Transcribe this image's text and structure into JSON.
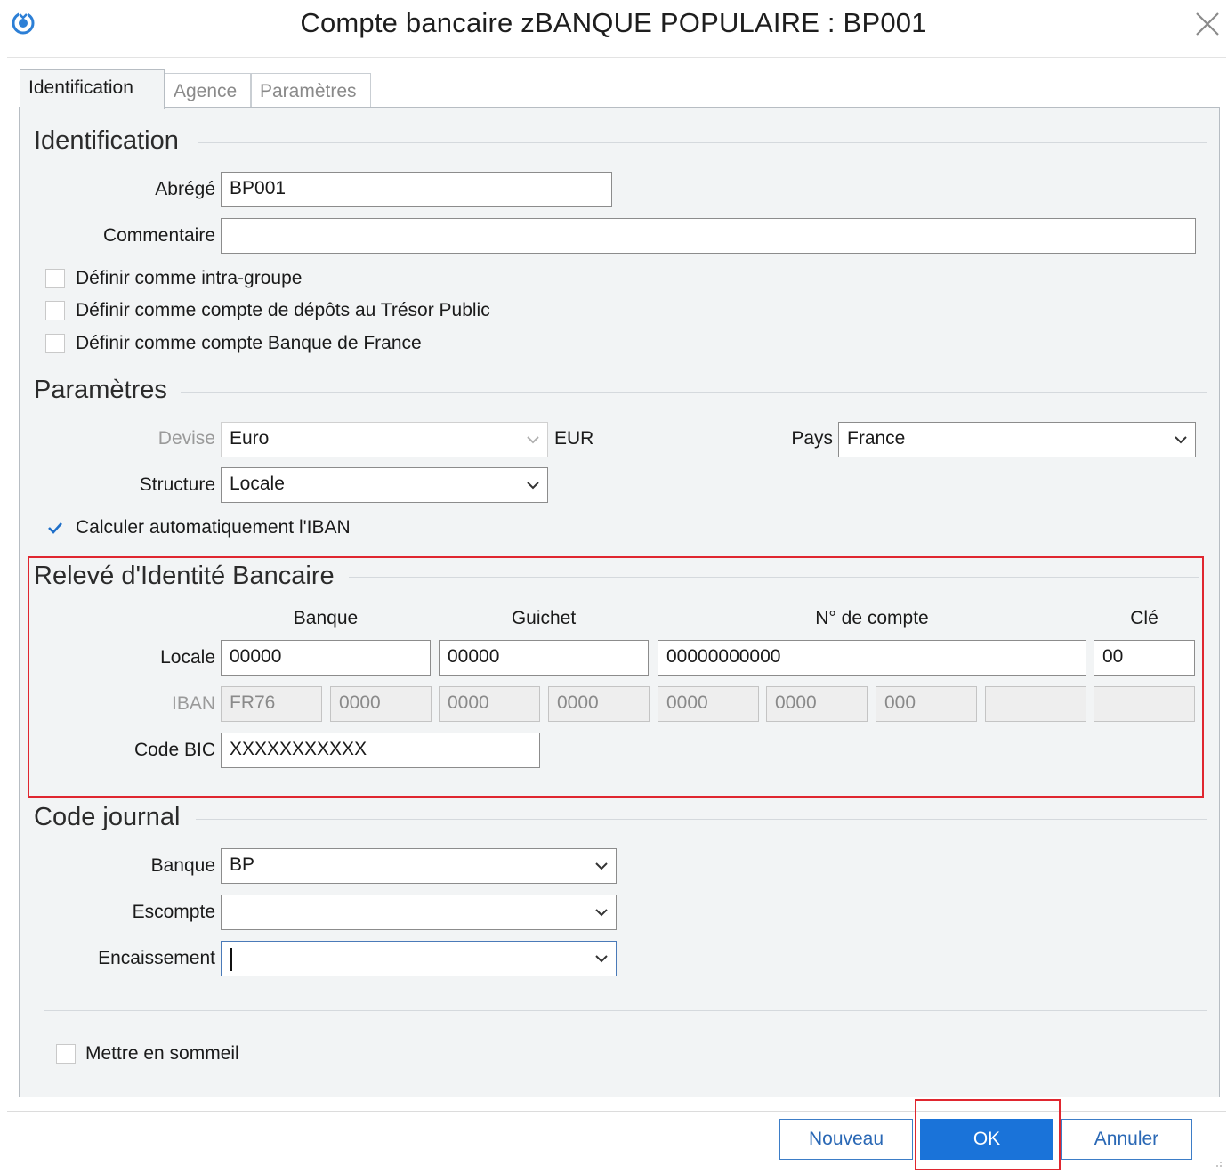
{
  "window": {
    "title": "Compte bancaire zBANQUE POPULAIRE : BP001"
  },
  "tabs": [
    {
      "label": "Identification",
      "active": true
    },
    {
      "label": "Agence",
      "active": false
    },
    {
      "label": "Paramètres",
      "active": false
    }
  ],
  "identification": {
    "section_title": "Identification",
    "abrege": {
      "label": "Abrégé",
      "value": "BP001"
    },
    "commentaire": {
      "label": "Commentaire",
      "value": ""
    },
    "checkboxes": [
      {
        "label": "Définir comme intra-groupe",
        "checked": false
      },
      {
        "label": "Définir comme compte de dépôts au Trésor Public",
        "checked": false
      },
      {
        "label": "Définir comme compte Banque de France",
        "checked": false
      }
    ]
  },
  "parametres": {
    "section_title": "Paramètres",
    "devise": {
      "label": "Devise",
      "value": "Euro",
      "code": "EUR"
    },
    "pays": {
      "label": "Pays",
      "value": "France"
    },
    "structure": {
      "label": "Structure",
      "value": "Locale"
    },
    "auto_iban": {
      "label": "Calculer automatiquement l'IBAN",
      "checked": true
    }
  },
  "rib": {
    "section_title": "Relevé d'Identité Bancaire",
    "columns": {
      "banque": "Banque",
      "guichet": "Guichet",
      "compte": "N° de compte",
      "cle": "Clé"
    },
    "locale": {
      "label": "Locale",
      "banque": "00000",
      "guichet": "00000",
      "compte": "00000000000",
      "cle": "00"
    },
    "iban": {
      "label": "IBAN",
      "parts": [
        "FR76",
        "0000",
        "0000",
        "0000",
        "0000",
        "0000",
        "000",
        "",
        ""
      ]
    },
    "bic": {
      "label": "Code BIC",
      "value": "XXXXXXXXXXX"
    }
  },
  "journal": {
    "section_title": "Code journal",
    "banque": {
      "label": "Banque",
      "value": "BP"
    },
    "escompte": {
      "label": "Escompte",
      "value": ""
    },
    "encaissement": {
      "label": "Encaissement",
      "value": ""
    }
  },
  "sommeil": {
    "label": "Mettre en sommeil",
    "checked": false
  },
  "buttons": {
    "nouveau": "Nouveau",
    "ok": "OK",
    "annuler": "Annuler"
  },
  "colors": {
    "accent": "#1a73d9",
    "highlight": "#e0262f",
    "panel": "#f2f4f5"
  }
}
